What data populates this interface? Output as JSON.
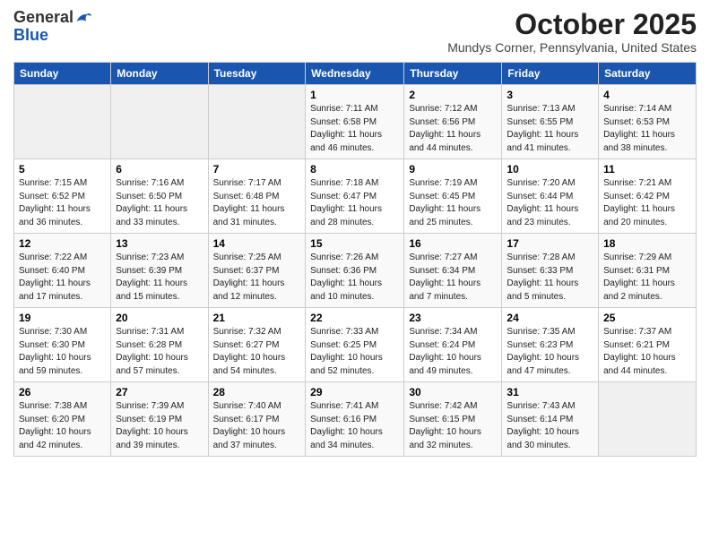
{
  "header": {
    "logo_line1": "General",
    "logo_line2": "Blue",
    "month": "October 2025",
    "location": "Mundys Corner, Pennsylvania, United States"
  },
  "weekdays": [
    "Sunday",
    "Monday",
    "Tuesday",
    "Wednesday",
    "Thursday",
    "Friday",
    "Saturday"
  ],
  "weeks": [
    [
      {
        "day": "",
        "info": ""
      },
      {
        "day": "",
        "info": ""
      },
      {
        "day": "",
        "info": ""
      },
      {
        "day": "1",
        "info": "Sunrise: 7:11 AM\nSunset: 6:58 PM\nDaylight: 11 hours\nand 46 minutes."
      },
      {
        "day": "2",
        "info": "Sunrise: 7:12 AM\nSunset: 6:56 PM\nDaylight: 11 hours\nand 44 minutes."
      },
      {
        "day": "3",
        "info": "Sunrise: 7:13 AM\nSunset: 6:55 PM\nDaylight: 11 hours\nand 41 minutes."
      },
      {
        "day": "4",
        "info": "Sunrise: 7:14 AM\nSunset: 6:53 PM\nDaylight: 11 hours\nand 38 minutes."
      }
    ],
    [
      {
        "day": "5",
        "info": "Sunrise: 7:15 AM\nSunset: 6:52 PM\nDaylight: 11 hours\nand 36 minutes."
      },
      {
        "day": "6",
        "info": "Sunrise: 7:16 AM\nSunset: 6:50 PM\nDaylight: 11 hours\nand 33 minutes."
      },
      {
        "day": "7",
        "info": "Sunrise: 7:17 AM\nSunset: 6:48 PM\nDaylight: 11 hours\nand 31 minutes."
      },
      {
        "day": "8",
        "info": "Sunrise: 7:18 AM\nSunset: 6:47 PM\nDaylight: 11 hours\nand 28 minutes."
      },
      {
        "day": "9",
        "info": "Sunrise: 7:19 AM\nSunset: 6:45 PM\nDaylight: 11 hours\nand 25 minutes."
      },
      {
        "day": "10",
        "info": "Sunrise: 7:20 AM\nSunset: 6:44 PM\nDaylight: 11 hours\nand 23 minutes."
      },
      {
        "day": "11",
        "info": "Sunrise: 7:21 AM\nSunset: 6:42 PM\nDaylight: 11 hours\nand 20 minutes."
      }
    ],
    [
      {
        "day": "12",
        "info": "Sunrise: 7:22 AM\nSunset: 6:40 PM\nDaylight: 11 hours\nand 17 minutes."
      },
      {
        "day": "13",
        "info": "Sunrise: 7:23 AM\nSunset: 6:39 PM\nDaylight: 11 hours\nand 15 minutes."
      },
      {
        "day": "14",
        "info": "Sunrise: 7:25 AM\nSunset: 6:37 PM\nDaylight: 11 hours\nand 12 minutes."
      },
      {
        "day": "15",
        "info": "Sunrise: 7:26 AM\nSunset: 6:36 PM\nDaylight: 11 hours\nand 10 minutes."
      },
      {
        "day": "16",
        "info": "Sunrise: 7:27 AM\nSunset: 6:34 PM\nDaylight: 11 hours\nand 7 minutes."
      },
      {
        "day": "17",
        "info": "Sunrise: 7:28 AM\nSunset: 6:33 PM\nDaylight: 11 hours\nand 5 minutes."
      },
      {
        "day": "18",
        "info": "Sunrise: 7:29 AM\nSunset: 6:31 PM\nDaylight: 11 hours\nand 2 minutes."
      }
    ],
    [
      {
        "day": "19",
        "info": "Sunrise: 7:30 AM\nSunset: 6:30 PM\nDaylight: 10 hours\nand 59 minutes."
      },
      {
        "day": "20",
        "info": "Sunrise: 7:31 AM\nSunset: 6:28 PM\nDaylight: 10 hours\nand 57 minutes."
      },
      {
        "day": "21",
        "info": "Sunrise: 7:32 AM\nSunset: 6:27 PM\nDaylight: 10 hours\nand 54 minutes."
      },
      {
        "day": "22",
        "info": "Sunrise: 7:33 AM\nSunset: 6:25 PM\nDaylight: 10 hours\nand 52 minutes."
      },
      {
        "day": "23",
        "info": "Sunrise: 7:34 AM\nSunset: 6:24 PM\nDaylight: 10 hours\nand 49 minutes."
      },
      {
        "day": "24",
        "info": "Sunrise: 7:35 AM\nSunset: 6:23 PM\nDaylight: 10 hours\nand 47 minutes."
      },
      {
        "day": "25",
        "info": "Sunrise: 7:37 AM\nSunset: 6:21 PM\nDaylight: 10 hours\nand 44 minutes."
      }
    ],
    [
      {
        "day": "26",
        "info": "Sunrise: 7:38 AM\nSunset: 6:20 PM\nDaylight: 10 hours\nand 42 minutes."
      },
      {
        "day": "27",
        "info": "Sunrise: 7:39 AM\nSunset: 6:19 PM\nDaylight: 10 hours\nand 39 minutes."
      },
      {
        "day": "28",
        "info": "Sunrise: 7:40 AM\nSunset: 6:17 PM\nDaylight: 10 hours\nand 37 minutes."
      },
      {
        "day": "29",
        "info": "Sunrise: 7:41 AM\nSunset: 6:16 PM\nDaylight: 10 hours\nand 34 minutes."
      },
      {
        "day": "30",
        "info": "Sunrise: 7:42 AM\nSunset: 6:15 PM\nDaylight: 10 hours\nand 32 minutes."
      },
      {
        "day": "31",
        "info": "Sunrise: 7:43 AM\nSunset: 6:14 PM\nDaylight: 10 hours\nand 30 minutes."
      },
      {
        "day": "",
        "info": ""
      }
    ]
  ]
}
